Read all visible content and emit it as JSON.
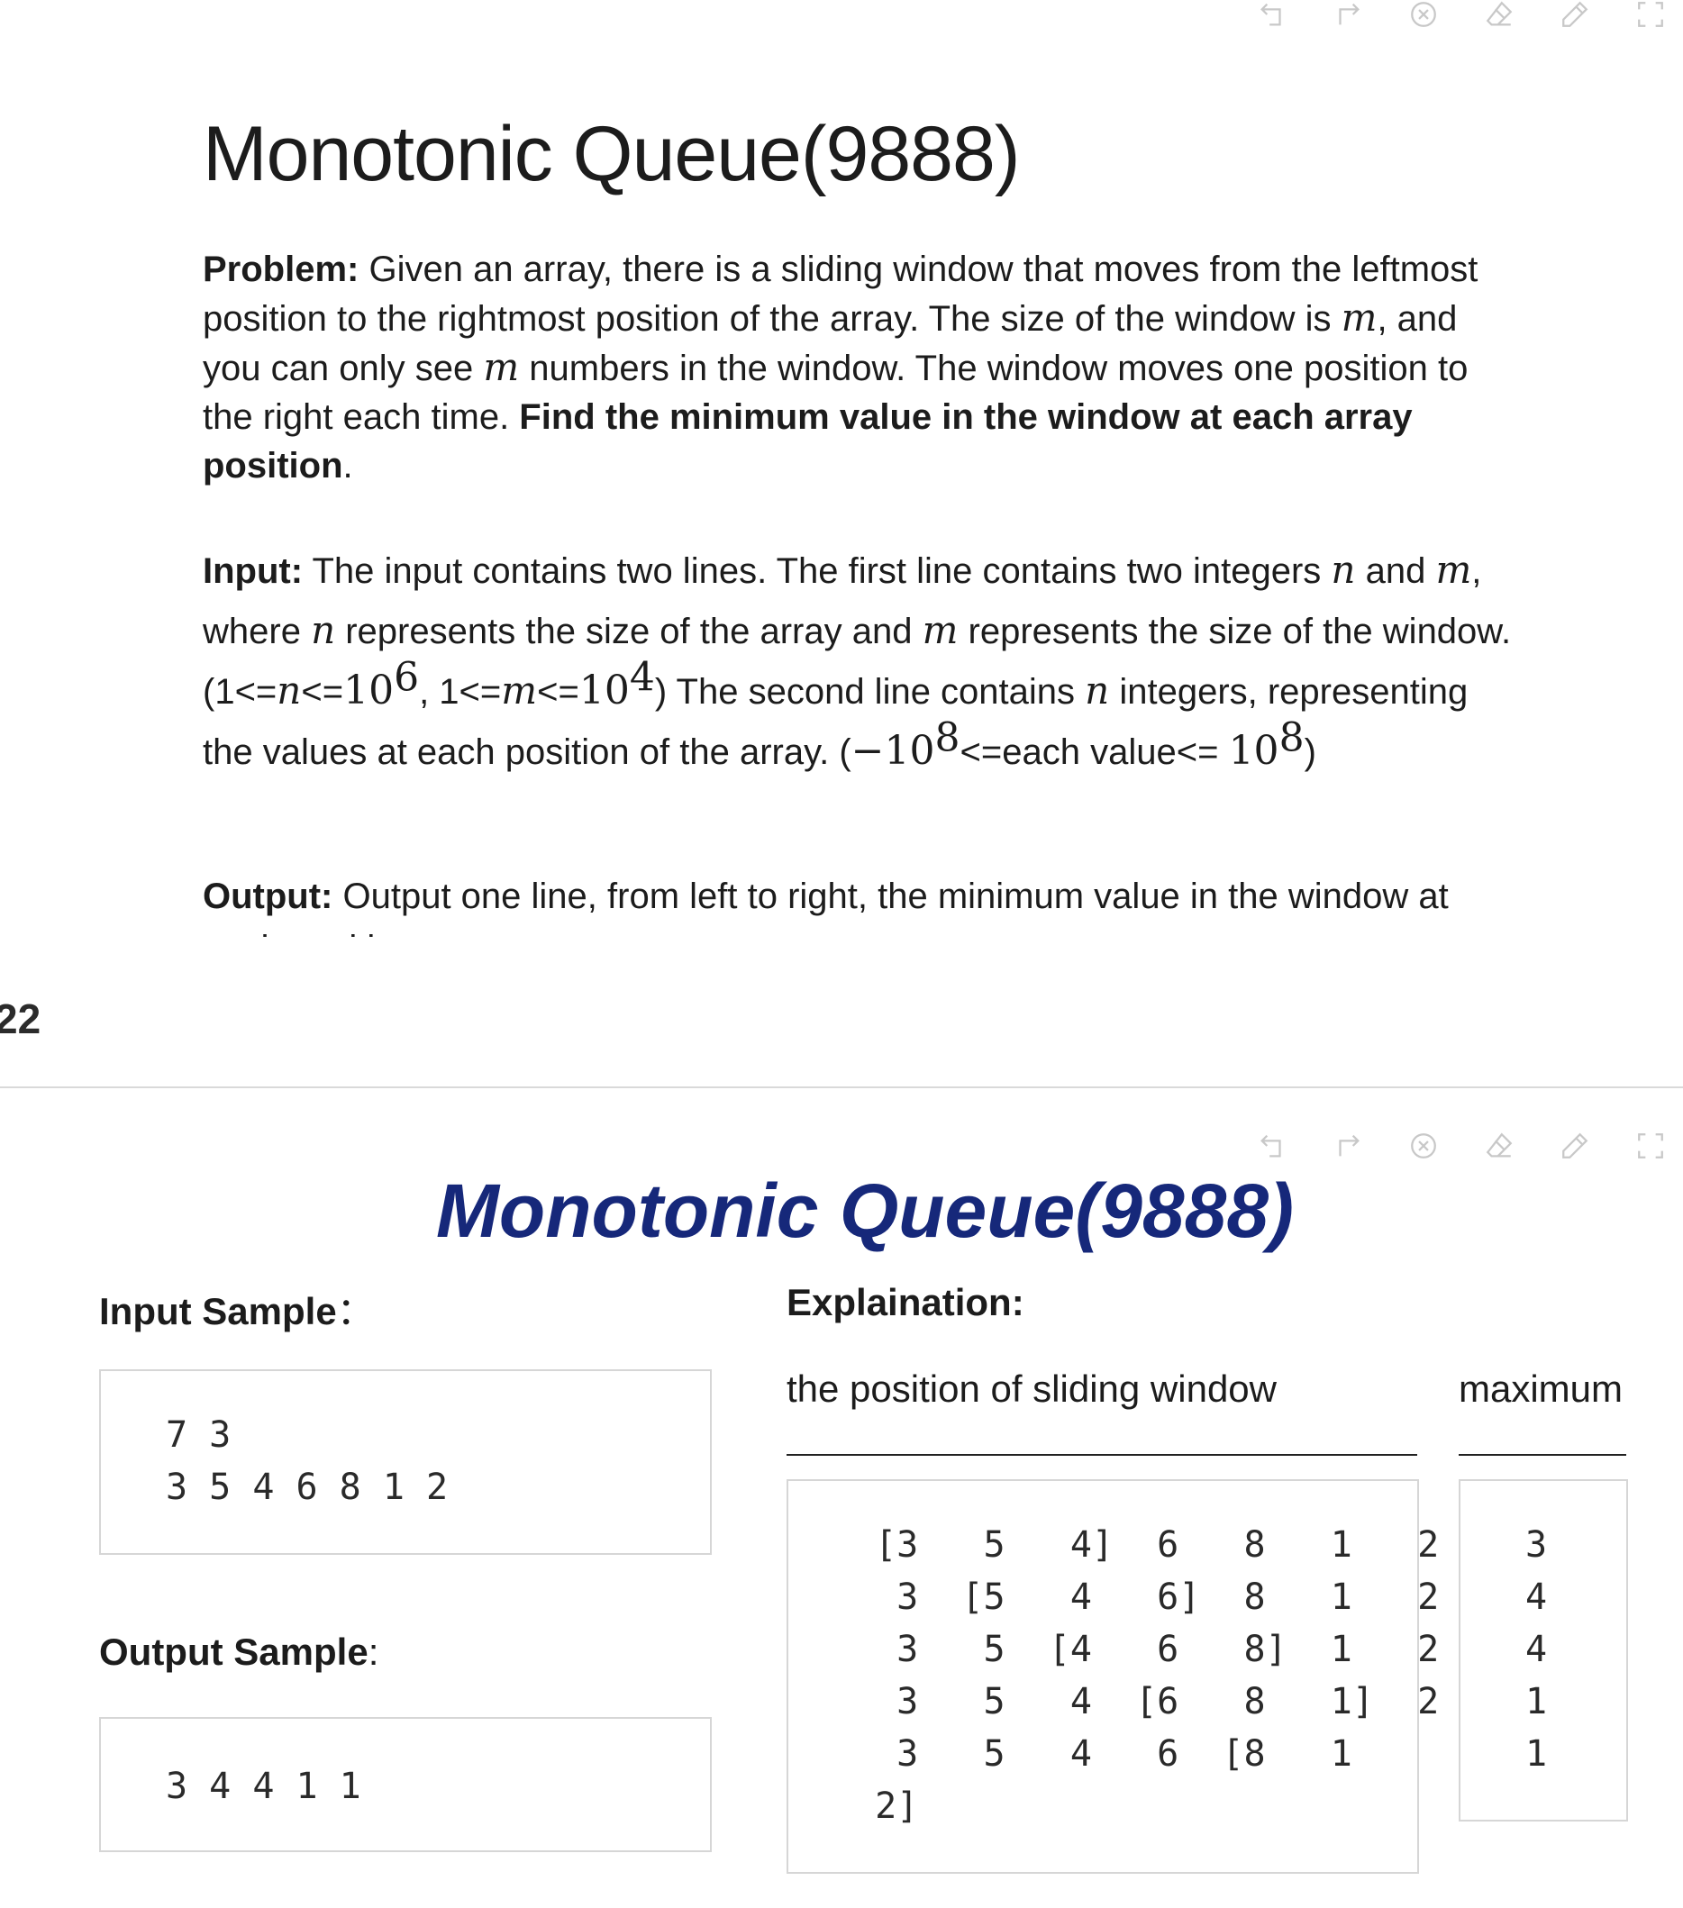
{
  "toolbar_icons": [
    "undo-icon",
    "redo-icon",
    "close-circle-icon",
    "eraser-icon",
    "pencil-icon",
    "fullscreen-icon"
  ],
  "card1": {
    "title": "Monotonic Queue(9888)",
    "problem": {
      "label": "Problem:",
      "t1": " Given an array, there is a sliding window that moves from the leftmost position to the rightmost position of the array. The size of the window is ",
      "m1": "m",
      "t2": ", and you can only see ",
      "m2": "m",
      "t3": " numbers in the window. The window moves one position to the right each time. ",
      "bold": "Find the minimum value in the window at each array position",
      "t4": "."
    },
    "input": {
      "label": "Input:",
      "t1": " The input contains two lines. The first line contains two integers ",
      "n1": "n",
      "t2": " and ",
      "m1": "m",
      "t3": ", where ",
      "n2": "n",
      "t4": " represents the size of the array and ",
      "m2": "m",
      "t5": " represents the size of the window. (1<=",
      "n3": "n",
      "t6": "<=",
      "e1_base": "10",
      "e1_exp": "6",
      "t7": ", 1<=",
      "m3": "m",
      "t8": "<=",
      "e2_base": "10",
      "e2_exp": "4",
      "t9": ") The second line contains ",
      "n4": "n",
      "t10": " integers, representing the values at each position of the array. (",
      "e3_base": "−10",
      "e3_exp": "8",
      "t11": "<=each value<= ",
      "e4_base": "10",
      "e4_exp": "8",
      "t12": ")"
    },
    "output": {
      "label": "Output:",
      "text": " Output one line, from left to right, the minimum value in the window at each position."
    }
  },
  "page_number": "22",
  "card2": {
    "title": "Monotonic Queue(9888)",
    "input_sample_label": "Input Sample",
    "input_sample_colon": "：",
    "input_sample": "7 3\n3 5 4 6 8 1 2",
    "output_sample_label": "Output Sample",
    "output_sample_colon": ":",
    "output_sample": "3 4 4 1 1",
    "explanation_label": "Explaination:",
    "window_header": "the position of sliding window",
    "max_header": "maximum",
    "window_rows": " [3   5   4]  6   8   1   2\n  3  [5   4   6]  8   1   2\n  3   5  [4   6   8]  1   2\n  3   5   4  [6   8   1]  2\n  3   5   4   6  [8   1\n 2]",
    "max_values": "3\n4\n4\n1\n1"
  }
}
